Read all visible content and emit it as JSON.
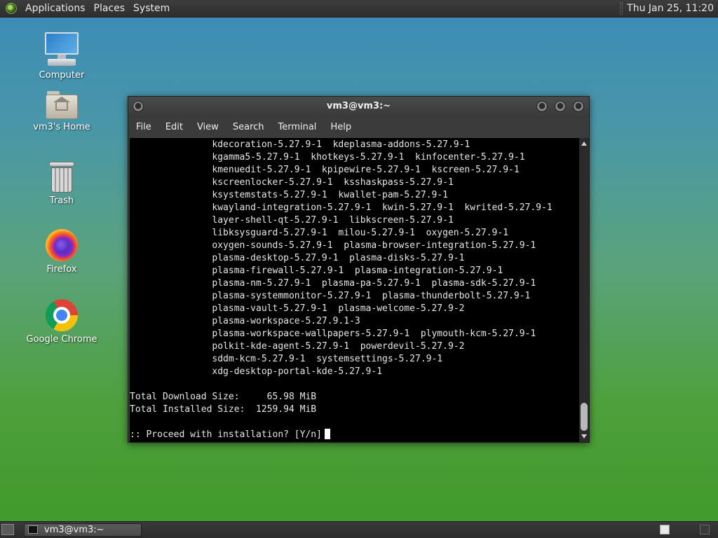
{
  "top_panel": {
    "menus": [
      "Applications",
      "Places",
      "System"
    ],
    "clock": "Thu Jan 25, 11:20"
  },
  "desktop_icons": [
    {
      "label": "Computer",
      "icon": "computer-icon"
    },
    {
      "label": "vm3's Home",
      "icon": "home-folder-icon"
    },
    {
      "label": "Trash",
      "icon": "trash-icon"
    },
    {
      "label": "Firefox",
      "icon": "firefox-icon"
    },
    {
      "label": "Google Chrome",
      "icon": "chrome-icon"
    }
  ],
  "window": {
    "title": "vm3@vm3:~",
    "menu": [
      "File",
      "Edit",
      "View",
      "Search",
      "Terminal",
      "Help"
    ]
  },
  "terminal": {
    "lines": [
      "               kdecoration-5.27.9-1  kdeplasma-addons-5.27.9-1",
      "               kgamma5-5.27.9-1  khotkeys-5.27.9-1  kinfocenter-5.27.9-1",
      "               kmenuedit-5.27.9-1  kpipewire-5.27.9-1  kscreen-5.27.9-1",
      "               kscreenlocker-5.27.9-1  ksshaskpass-5.27.9-1",
      "               ksystemstats-5.27.9-1  kwallet-pam-5.27.9-1",
      "               kwayland-integration-5.27.9-1  kwin-5.27.9-1  kwrited-5.27.9-1",
      "               layer-shell-qt-5.27.9-1  libkscreen-5.27.9-1",
      "               libksysguard-5.27.9-1  milou-5.27.9-1  oxygen-5.27.9-1",
      "               oxygen-sounds-5.27.9-1  plasma-browser-integration-5.27.9-1",
      "               plasma-desktop-5.27.9-1  plasma-disks-5.27.9-1",
      "               plasma-firewall-5.27.9-1  plasma-integration-5.27.9-1",
      "               plasma-nm-5.27.9-1  plasma-pa-5.27.9-1  plasma-sdk-5.27.9-1",
      "               plasma-systemmonitor-5.27.9-1  plasma-thunderbolt-5.27.9-1",
      "               plasma-vault-5.27.9-1  plasma-welcome-5.27.9-2",
      "               plasma-workspace-5.27.9.1-3",
      "               plasma-workspace-wallpapers-5.27.9-1  plymouth-kcm-5.27.9-1",
      "               polkit-kde-agent-5.27.9-1  powerdevil-5.27.9-2",
      "               sddm-kcm-5.27.9-1  systemsettings-5.27.9-1",
      "               xdg-desktop-portal-kde-5.27.9-1",
      "",
      "Total Download Size:     65.98 MiB",
      "Total Installed Size:  1259.94 MiB",
      ""
    ],
    "prompt": ":: Proceed with installation? [Y/n]"
  },
  "taskbar": {
    "task_label": "vm3@vm3:~"
  }
}
